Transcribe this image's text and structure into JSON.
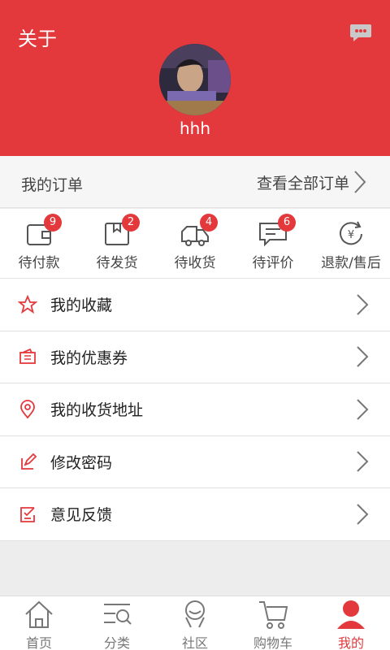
{
  "header": {
    "title": "关于",
    "username": "hhh",
    "message_icon": "chat-bubble-icon"
  },
  "orders": {
    "title": "我的订单",
    "view_all": "查看全部订单",
    "items": [
      {
        "label": "待付款",
        "badge": "9",
        "icon": "wallet-icon"
      },
      {
        "label": "待发货",
        "badge": "2",
        "icon": "package-icon"
      },
      {
        "label": "待收货",
        "badge": "4",
        "icon": "truck-icon"
      },
      {
        "label": "待评价",
        "badge": "6",
        "icon": "comment-icon"
      },
      {
        "label": "退款/售后",
        "badge": "",
        "icon": "refund-yen-icon"
      }
    ]
  },
  "menu": [
    {
      "label": "我的收藏",
      "icon": "star-icon"
    },
    {
      "label": "我的优惠券",
      "icon": "coupon-icon"
    },
    {
      "label": "我的收货地址",
      "icon": "location-pin-icon"
    },
    {
      "label": "修改密码",
      "icon": "edit-icon"
    },
    {
      "label": "意见反馈",
      "icon": "feedback-icon"
    }
  ],
  "tabs": [
    {
      "label": "首页",
      "icon": "home-icon"
    },
    {
      "label": "分类",
      "icon": "category-search-icon"
    },
    {
      "label": "社区",
      "icon": "community-icon"
    },
    {
      "label": "购物车",
      "icon": "cart-icon"
    },
    {
      "label": "我的",
      "icon": "user-icon",
      "active": true
    }
  ],
  "colors": {
    "brand": "#e4393c",
    "text": "#444444",
    "background": "#ededed"
  }
}
